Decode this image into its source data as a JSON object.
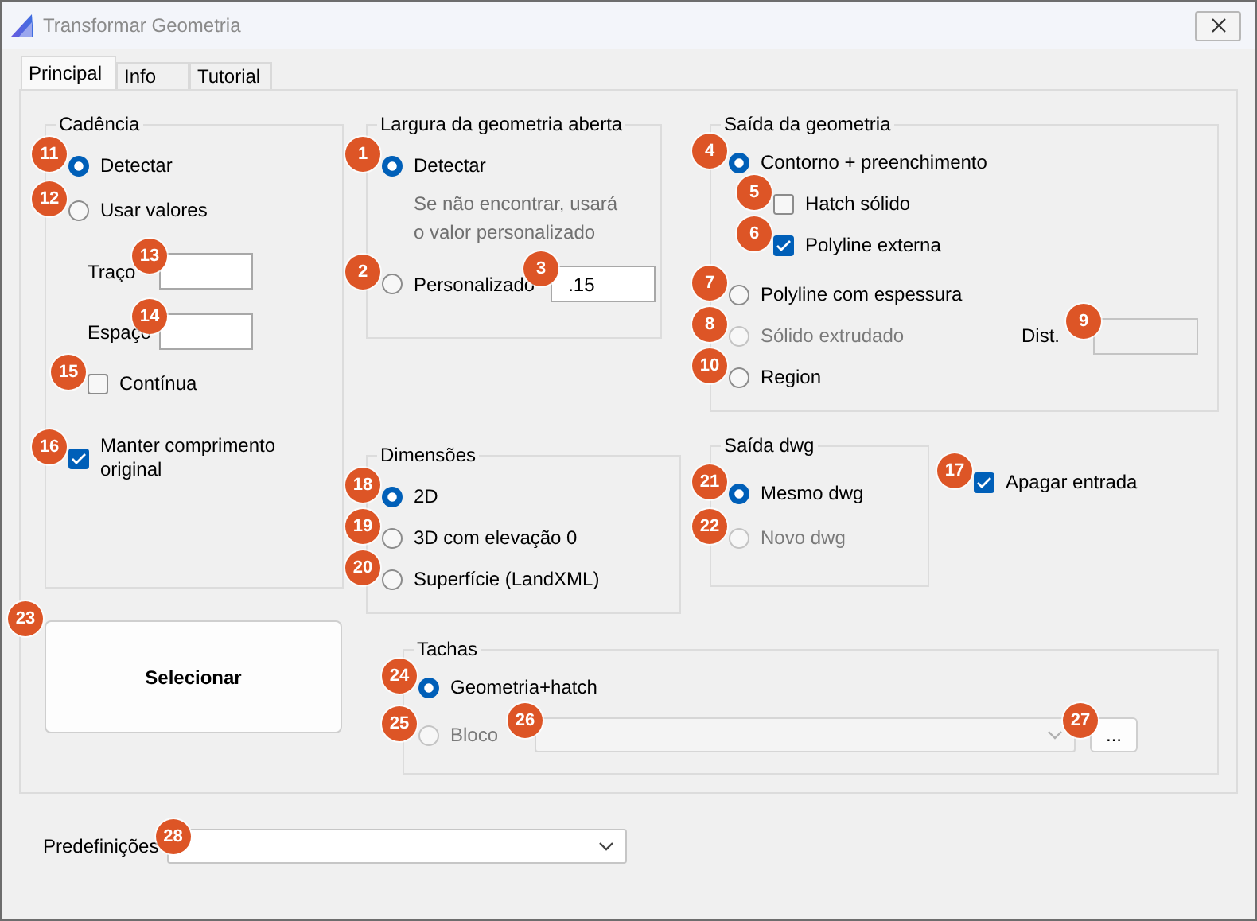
{
  "window": {
    "title": "Transformar Geometria"
  },
  "tabs": [
    {
      "label": "Principal",
      "selected": true
    },
    {
      "label": "Info",
      "selected": false
    },
    {
      "label": "Tutorial",
      "selected": false
    }
  ],
  "cadence": {
    "title": "Cadência",
    "items": [
      {
        "kind": "radio",
        "label": "Detectar",
        "badge": "11",
        "selected": true,
        "disabled": false
      },
      {
        "kind": "radio",
        "label": "Usar valores",
        "badge": "12",
        "selected": false,
        "disabled": false,
        "children": [
          {
            "kind": "field",
            "label": "Traço",
            "badge": "13",
            "disabled": false
          },
          {
            "kind": "field",
            "label": "Espaço",
            "badge": "14",
            "disabled": false
          },
          {
            "kind": "checkbox",
            "label": "Contínua",
            "badge": "15",
            "checked": false,
            "disabled": false
          }
        ]
      },
      {
        "kind": "checkbox",
        "label": "Manter comprimento original",
        "badge": "16",
        "checked": true,
        "disabled": false
      }
    ]
  },
  "open_width": {
    "title": "Largura da geometria aberta",
    "items": [
      {
        "kind": "radio",
        "label": "Detectar",
        "badge": "1",
        "selected": true,
        "disabled": false
      },
      {
        "kind": "note",
        "text": "Se não encontrar, usará o valor personalizado"
      },
      {
        "kind": "radio",
        "label": "Personalizado",
        "badge": "2",
        "selected": false,
        "disabled": false,
        "field": {
          "value": ".15",
          "badge": "3",
          "disabled": false
        }
      }
    ]
  },
  "geometry_output": {
    "title": "Saída da geometria",
    "items": [
      {
        "kind": "radio",
        "label": "Contorno + preenchimento",
        "badge": "4",
        "selected": true,
        "disabled": false,
        "children": [
          {
            "kind": "checkbox",
            "label": "Hatch sólido",
            "badge": "5",
            "checked": false,
            "disabled": false
          },
          {
            "kind": "checkbox",
            "label": "Polyline externa",
            "badge": "6",
            "checked": true,
            "disabled": false
          }
        ]
      },
      {
        "kind": "radio",
        "label": "Polyline com espessura",
        "badge": "7",
        "selected": false,
        "disabled": false
      },
      {
        "kind": "radio",
        "label": "Sólido extrudado",
        "badge": "8",
        "selected": false,
        "disabled": true,
        "field": {
          "label": "Dist.",
          "badge": "9",
          "disabled": true
        }
      },
      {
        "kind": "radio",
        "label": "Region",
        "badge": "10",
        "selected": false,
        "disabled": false
      }
    ]
  },
  "dimensions": {
    "title": "Dimensões",
    "items": [
      {
        "kind": "radio",
        "label": "2D",
        "badge": "18",
        "selected": true,
        "disabled": false
      },
      {
        "kind": "radio",
        "label": "3D com elevação 0",
        "badge": "19",
        "selected": false,
        "disabled": false
      },
      {
        "kind": "radio",
        "label": "Superfície (LandXML)",
        "badge": "20",
        "selected": false,
        "disabled": false
      }
    ]
  },
  "dwg_output": {
    "title": "Saída dwg",
    "items": [
      {
        "kind": "radio",
        "label": "Mesmo dwg",
        "badge": "21",
        "selected": true,
        "disabled": false
      },
      {
        "kind": "radio",
        "label": "Novo dwg",
        "badge": "22",
        "selected": false,
        "disabled": true
      }
    ]
  },
  "erase_input": {
    "kind": "checkbox",
    "label": "Apagar entrada",
    "badge": "17",
    "checked": true,
    "disabled": false
  },
  "select_button": {
    "label": "Selecionar",
    "badge": "23"
  },
  "tacks": {
    "title": "Tachas",
    "items": [
      {
        "kind": "radio",
        "label": "Geometria+hatch",
        "badge": "24",
        "selected": true,
        "disabled": false
      },
      {
        "kind": "radio",
        "label": "Bloco",
        "badge": "25",
        "selected": false,
        "disabled": true,
        "combo": {
          "badge": "26",
          "disabled": true
        },
        "button": {
          "label": "...",
          "badge": "27"
        }
      }
    ]
  },
  "presets": {
    "label": "Predefinições",
    "badge": "28"
  }
}
